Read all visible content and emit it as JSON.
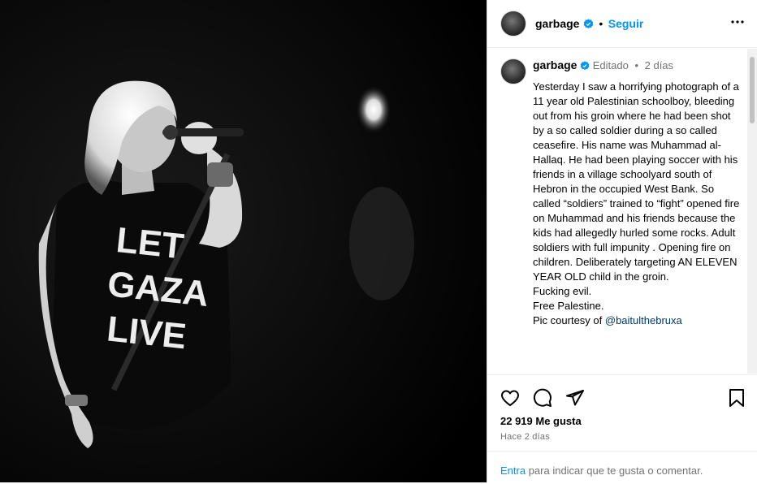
{
  "post": {
    "username": "garbage",
    "follow_label": "Seguir",
    "edited_label": "Editado",
    "separator": "•",
    "time_short": "2 días",
    "caption": "Yesterday I saw a horrifying photograph of a 11 year old Palestinian schoolboy, bleeding out from his groin where he had been shot by a so called soldier during a so called ceasefire. His name was Muhammad al-Hallaq. He had been playing soccer with his friends in a village schoolyard south of Hebron in the occupied West Bank. So called “soldiers” trained to “fight” opened fire on Muhammad and his friends because the kids had allegedly hurled some rocks. Adult soldiers with full impunity . Opening fire on children. Deliberately targeting AN ELEVEN YEAR OLD child in the groin.\nFucking evil.\nFree Palestine.\nPic courtesy of ",
    "mention": "@baitulthebruxa",
    "likes": "22 919 Me gusta",
    "time_long": "Hace 2 días"
  },
  "photo": {
    "shirt_text": [
      "LET",
      "GAZA",
      "LIVE"
    ]
  },
  "login_prompt": {
    "link": "Entra",
    "text": " para indicar que te gusta o comentar."
  },
  "icons": {
    "verified": "verified-badge-icon",
    "more": "more-options-icon",
    "like": "heart-icon",
    "comment": "comment-icon",
    "share": "share-icon",
    "save": "bookmark-icon"
  },
  "colors": {
    "accent": "#0095f6",
    "link": "#00376b",
    "secondary": "#737373"
  }
}
